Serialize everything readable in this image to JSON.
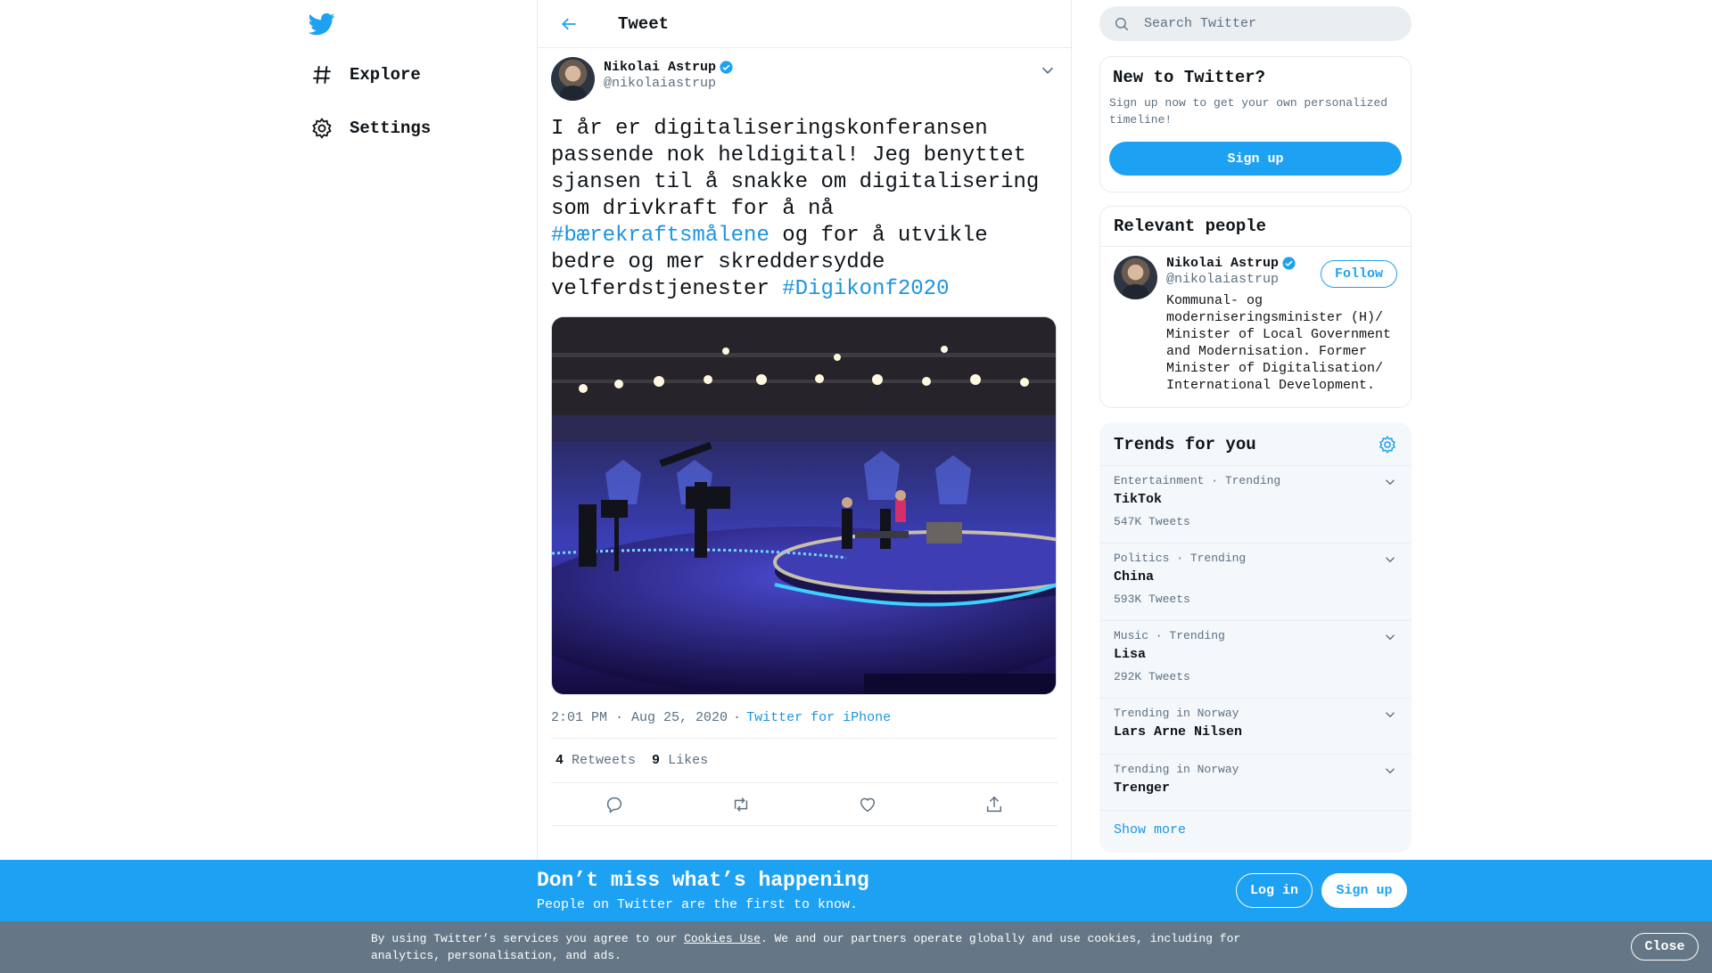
{
  "nav": {
    "logo_icon": "twitter-bird-icon",
    "items": [
      {
        "label": "Explore",
        "icon": "hashtag-icon"
      },
      {
        "label": "Settings",
        "icon": "gear-icon"
      }
    ]
  },
  "header": {
    "title": "Tweet"
  },
  "tweet": {
    "author_name": "Nikolai Astrup",
    "author_handle": "@nikolaiastrup",
    "text_before": "I år er digitaliseringskonferansen passende nok heldigital! Jeg benyttet sjansen til å snakke om digitalisering som drivkraft for å nå ",
    "hashtag_1": "#bærekraftsmålene",
    "text_middle": " og for å utvikle bedre og mer skreddersydde velferdstjenester ",
    "hashtag_2": "#Digikonf2020",
    "time": "2:01 PM · Aug 25, 2020",
    "source": "Twitter for iPhone",
    "retweets_count": "4",
    "retweets_label": "Retweets",
    "likes_count": "9",
    "likes_label": "Likes"
  },
  "search": {
    "placeholder": "Search Twitter"
  },
  "new_to_twitter": {
    "title": "New to Twitter?",
    "subtitle": "Sign up now to get your own personalized timeline!",
    "button": "Sign up"
  },
  "relevant_people": {
    "title": "Relevant people",
    "name": "Nikolai Astrup",
    "handle": "@nikolaiastrup",
    "follow": "Follow",
    "bio": "Kommunal- og moderniseringsminister (H)/ Minister of Local Government and Modernisation. Former Minister of Digitalisation/ International Development."
  },
  "trends": {
    "title": "Trends for you",
    "items": [
      {
        "context": "Entertainment · Trending",
        "name": "TikTok",
        "count": "547K Tweets"
      },
      {
        "context": "Politics · Trending",
        "name": "China",
        "count": "593K Tweets"
      },
      {
        "context": "Music · Trending",
        "name": "Lisa",
        "count": "292K Tweets"
      },
      {
        "context": "Trending in Norway",
        "name": "Lars Arne Nilsen",
        "count": ""
      },
      {
        "context": "Trending in Norway",
        "name": "Trenger",
        "count": ""
      }
    ],
    "show_more": "Show more"
  },
  "cta": {
    "title": "Don’t miss what’s happening",
    "subtitle": "People on Twitter are the first to know.",
    "login": "Log in",
    "signup": "Sign up"
  },
  "cookie": {
    "text_before": "By using Twitter’s services you agree to our ",
    "link": "Cookies Use",
    "text_after": ". We and our partners operate globally and use cookies, including for analytics, personalisation, and ads.",
    "close": "Close"
  },
  "colors": {
    "brand": "#1da1f2",
    "link": "#1b95e0",
    "muted": "#5b7083",
    "cookie_bg": "#657786"
  }
}
